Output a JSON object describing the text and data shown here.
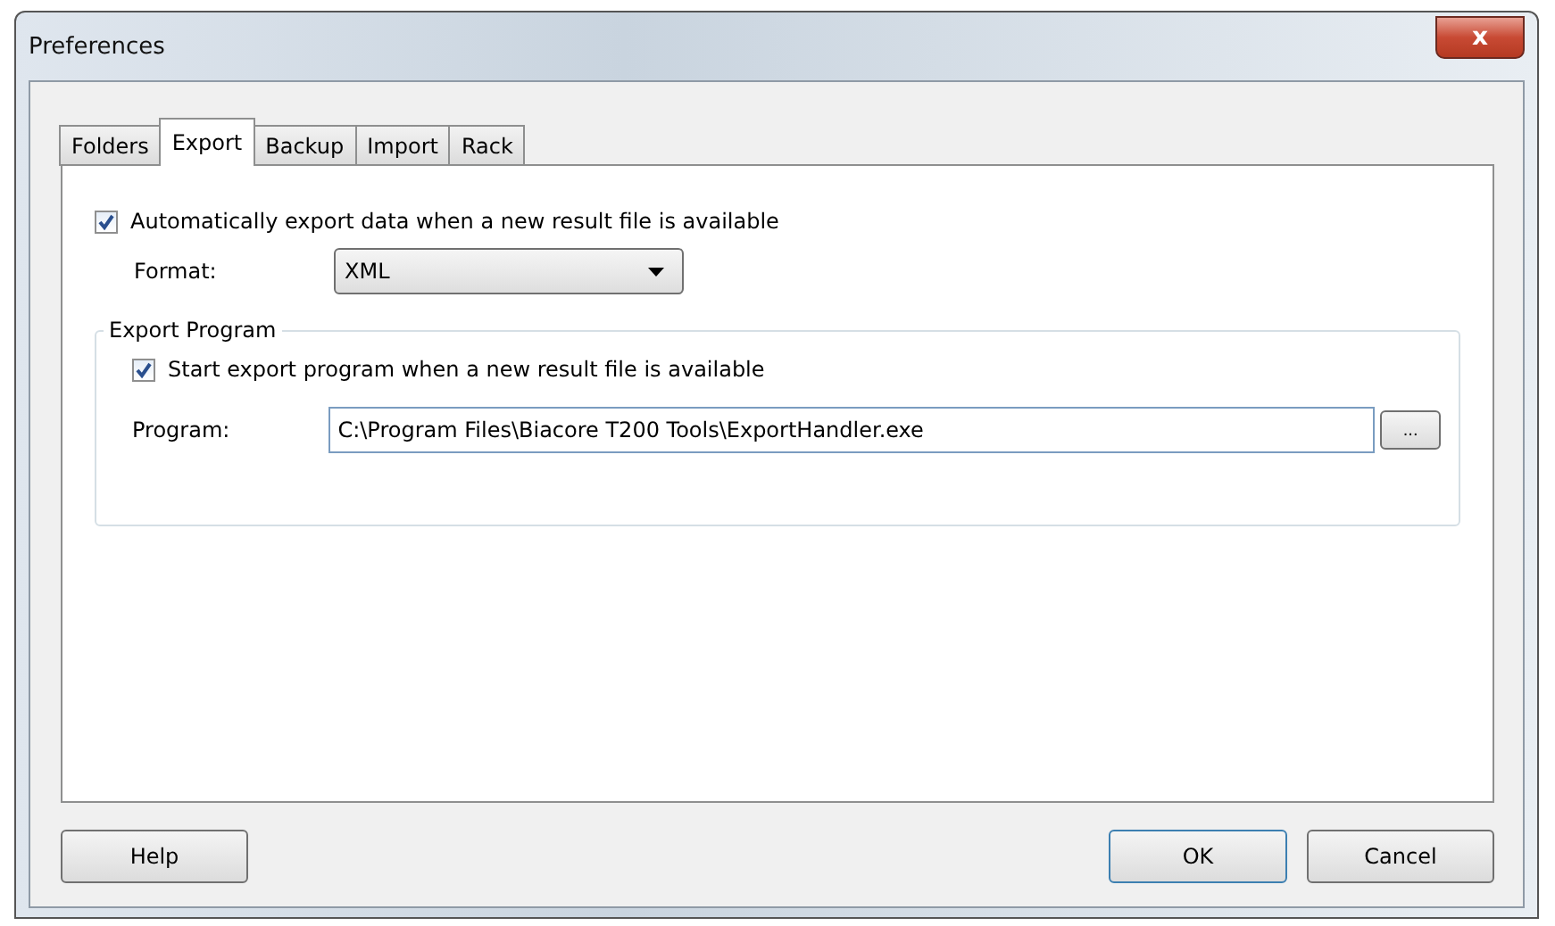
{
  "window": {
    "title": "Preferences",
    "close": "x"
  },
  "tabs": [
    {
      "label": "Folders",
      "selected": false
    },
    {
      "label": "Export",
      "selected": true
    },
    {
      "label": "Backup",
      "selected": false
    },
    {
      "label": "Import",
      "selected": false
    },
    {
      "label": "Rack",
      "selected": false
    }
  ],
  "auto_export": {
    "label": "Automatically export data when a new result file is available",
    "checked": true
  },
  "format": {
    "label": "Format:",
    "value": "XML"
  },
  "export_program": {
    "title": "Export Program",
    "start": {
      "label": "Start export program when a new result file is available",
      "checked": true
    },
    "program_label": "Program:",
    "program_value": "C:\\Program Files\\Biacore T200 Tools\\ExportHandler.exe",
    "browse": "..."
  },
  "buttons": {
    "help": "Help",
    "ok": "OK",
    "cancel": "Cancel"
  }
}
